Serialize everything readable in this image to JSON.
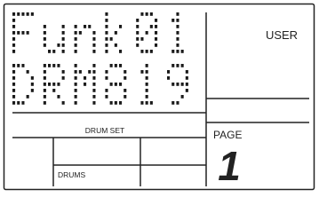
{
  "display": {
    "patch_line_1": "Funk01",
    "patch_line_2": "DRM819",
    "mode_label": "USER",
    "section_label": "DRUM SET",
    "page_label": "PAGE",
    "page_number": "1",
    "part_label": "DRUMS"
  },
  "colors": {
    "pixel": "#1a1a1a",
    "line": "#222222",
    "background": "#ffffff"
  }
}
